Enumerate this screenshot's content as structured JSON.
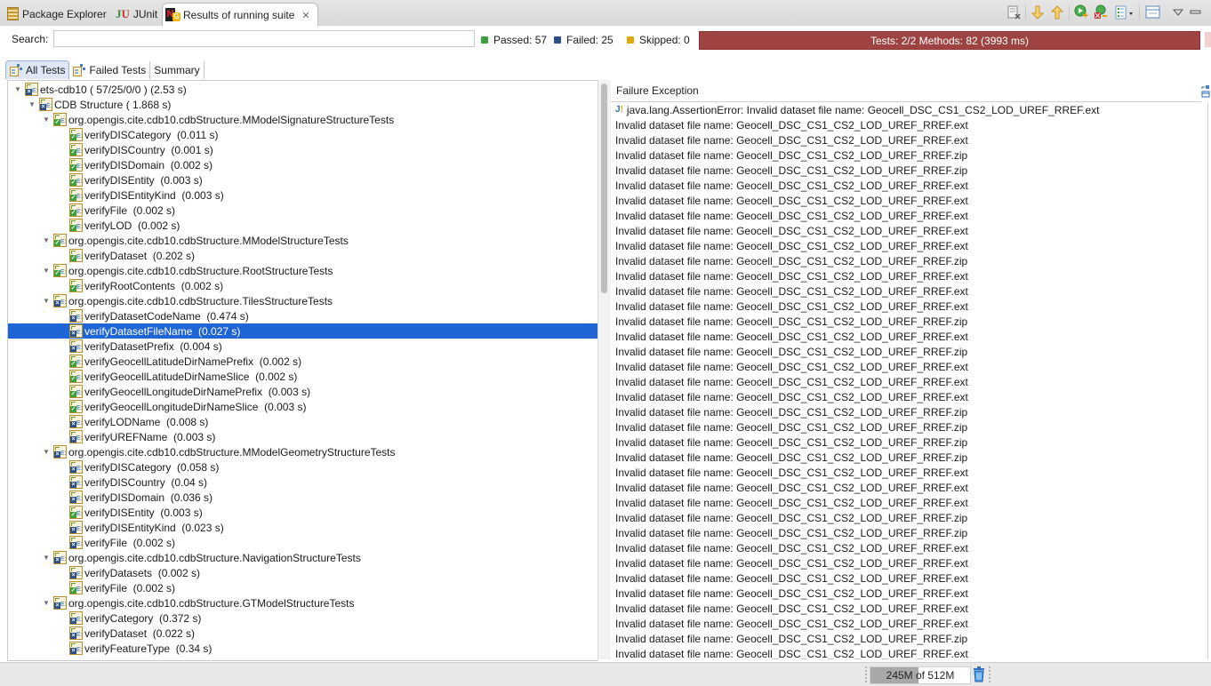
{
  "tabs": [
    {
      "label": "Package Explorer",
      "icon": "package-explorer-icon",
      "active": false
    },
    {
      "label": "JUnit",
      "icon": "junit-icon",
      "active": false
    },
    {
      "label": "Results of running suite",
      "icon": "testng-icon",
      "active": true,
      "closable": true
    }
  ],
  "toolbar": {
    "buttons": [
      "clear-results-icon",
      "next-failure-icon",
      "previous-failure-icon",
      "rerun-icon",
      "rerun-failed-icon",
      "history-menu-icon",
      "layout-icon",
      "view-menu-icon",
      "minimize-icon"
    ]
  },
  "search": {
    "label": "Search:",
    "value": "",
    "placeholder": ""
  },
  "stats": {
    "passed": "Passed: 57",
    "failed": "Failed: 25",
    "skipped": "Skipped: 0"
  },
  "progress": {
    "text": "Tests: 2/2  Methods: 82 (3993 ms)",
    "status_color": "#9e4242",
    "fraction": 1.0
  },
  "subtabs": [
    {
      "label": "All Tests",
      "active": true
    },
    {
      "label": "Failed Tests",
      "active": false
    },
    {
      "label": "Summary",
      "active": false
    }
  ],
  "tree": [
    {
      "level": 0,
      "expand": true,
      "status": "fail",
      "label": "ets-cdb10 ( 57/25/0/0 ) (2.53 s)"
    },
    {
      "level": 1,
      "expand": true,
      "status": "fail",
      "label": "CDB Structure ( 1.868 s)"
    },
    {
      "level": 2,
      "expand": true,
      "status": "pass",
      "label": "org.opengis.cite.cdb10.cdbStructure.MModelSignatureStructureTests"
    },
    {
      "level": 3,
      "status": "pass",
      "label": "verifyDISCategory  (0.011 s)"
    },
    {
      "level": 3,
      "status": "pass",
      "label": "verifyDISCountry  (0.001 s)"
    },
    {
      "level": 3,
      "status": "pass",
      "label": "verifyDISDomain  (0.002 s)"
    },
    {
      "level": 3,
      "status": "pass",
      "label": "verifyDISEntity  (0.003 s)"
    },
    {
      "level": 3,
      "status": "pass",
      "label": "verifyDISEntityKind  (0.003 s)"
    },
    {
      "level": 3,
      "status": "pass",
      "label": "verifyFile  (0.002 s)"
    },
    {
      "level": 3,
      "status": "pass",
      "label": "verifyLOD  (0.002 s)"
    },
    {
      "level": 2,
      "expand": true,
      "status": "pass",
      "label": "org.opengis.cite.cdb10.cdbStructure.MModelStructureTests"
    },
    {
      "level": 3,
      "status": "pass",
      "label": "verifyDataset  (0.202 s)"
    },
    {
      "level": 2,
      "expand": true,
      "status": "pass",
      "label": "org.opengis.cite.cdb10.cdbStructure.RootStructureTests"
    },
    {
      "level": 3,
      "status": "pass",
      "label": "verifyRootContents  (0.002 s)"
    },
    {
      "level": 2,
      "expand": true,
      "status": "fail",
      "label": "org.opengis.cite.cdb10.cdbStructure.TilesStructureTests"
    },
    {
      "level": 3,
      "status": "fail",
      "label": "verifyDatasetCodeName  (0.474 s)"
    },
    {
      "level": 3,
      "status": "fail",
      "label": "verifyDatasetFileName  (0.027 s)",
      "selected": true
    },
    {
      "level": 3,
      "status": "fail",
      "label": "verifyDatasetPrefix  (0.004 s)"
    },
    {
      "level": 3,
      "status": "pass",
      "label": "verifyGeocellLatitudeDirNamePrefix  (0.002 s)"
    },
    {
      "level": 3,
      "status": "pass",
      "label": "verifyGeocellLatitudeDirNameSlice  (0.002 s)"
    },
    {
      "level": 3,
      "status": "pass",
      "label": "verifyGeocellLongitudeDirNamePrefix  (0.003 s)"
    },
    {
      "level": 3,
      "status": "pass",
      "label": "verifyGeocellLongitudeDirNameSlice  (0.003 s)"
    },
    {
      "level": 3,
      "status": "fail",
      "label": "verifyLODName  (0.008 s)"
    },
    {
      "level": 3,
      "status": "fail",
      "label": "verifyUREFName  (0.003 s)"
    },
    {
      "level": 2,
      "expand": true,
      "status": "fail",
      "label": "org.opengis.cite.cdb10.cdbStructure.MModelGeometryStructureTests"
    },
    {
      "level": 3,
      "status": "fail",
      "label": "verifyDISCategory  (0.058 s)"
    },
    {
      "level": 3,
      "status": "fail",
      "label": "verifyDISCountry  (0.04 s)"
    },
    {
      "level": 3,
      "status": "fail",
      "label": "verifyDISDomain  (0.036 s)"
    },
    {
      "level": 3,
      "status": "pass",
      "label": "verifyDISEntity  (0.003 s)"
    },
    {
      "level": 3,
      "status": "fail",
      "label": "verifyDISEntityKind  (0.023 s)"
    },
    {
      "level": 3,
      "status": "fail",
      "label": "verifyFile  (0.002 s)"
    },
    {
      "level": 2,
      "expand": true,
      "status": "fail",
      "label": "org.opengis.cite.cdb10.cdbStructure.NavigationStructureTests"
    },
    {
      "level": 3,
      "status": "fail",
      "label": "verifyDatasets  (0.002 s)"
    },
    {
      "level": 3,
      "status": "pass",
      "label": "verifyFile  (0.002 s)"
    },
    {
      "level": 2,
      "expand": true,
      "status": "fail",
      "label": "org.opengis.cite.cdb10.cdbStructure.GTModelStructureTests"
    },
    {
      "level": 3,
      "status": "fail",
      "label": "verifyCategory  (0.372 s)"
    },
    {
      "level": 3,
      "status": "fail",
      "label": "verifyDataset  (0.022 s)"
    },
    {
      "level": 3,
      "status": "fail",
      "label": "verifyFeatureType  (0.34 s)"
    }
  ],
  "failure": {
    "header": "Failure Exception",
    "first_line": "java.lang.AssertionError: Invalid dataset file name: Geocell_DSC_CS1_CS2_LOD_UREF_RREF.ext",
    "line_prefix": "Invalid dataset file name: Geocell_DSC_CS1_CS2_LOD_UREF_RREF.",
    "lines": [
      "Invalid dataset file name: Geocell_DSC_CS1_CS2_LOD_UREF_RREF.ext",
      "Invalid dataset file name: Geocell_DSC_CS1_CS2_LOD_UREF_RREF.ext",
      "Invalid dataset file name: Geocell_DSC_CS1_CS2_LOD_UREF_RREF.zip",
      "Invalid dataset file name: Geocell_DSC_CS1_CS2_LOD_UREF_RREF.zip",
      "Invalid dataset file name: Geocell_DSC_CS1_CS2_LOD_UREF_RREF.ext",
      "Invalid dataset file name: Geocell_DSC_CS1_CS2_LOD_UREF_RREF.ext",
      "Invalid dataset file name: Geocell_DSC_CS1_CS2_LOD_UREF_RREF.ext",
      "Invalid dataset file name: Geocell_DSC_CS1_CS2_LOD_UREF_RREF.ext",
      "Invalid dataset file name: Geocell_DSC_CS1_CS2_LOD_UREF_RREF.ext",
      "Invalid dataset file name: Geocell_DSC_CS1_CS2_LOD_UREF_RREF.zip",
      "Invalid dataset file name: Geocell_DSC_CS1_CS2_LOD_UREF_RREF.ext",
      "Invalid dataset file name: Geocell_DSC_CS1_CS2_LOD_UREF_RREF.ext",
      "Invalid dataset file name: Geocell_DSC_CS1_CS2_LOD_UREF_RREF.ext",
      "Invalid dataset file name: Geocell_DSC_CS1_CS2_LOD_UREF_RREF.zip",
      "Invalid dataset file name: Geocell_DSC_CS1_CS2_LOD_UREF_RREF.ext",
      "Invalid dataset file name: Geocell_DSC_CS1_CS2_LOD_UREF_RREF.zip",
      "Invalid dataset file name: Geocell_DSC_CS1_CS2_LOD_UREF_RREF.ext",
      "Invalid dataset file name: Geocell_DSC_CS1_CS2_LOD_UREF_RREF.ext",
      "Invalid dataset file name: Geocell_DSC_CS1_CS2_LOD_UREF_RREF.ext",
      "Invalid dataset file name: Geocell_DSC_CS1_CS2_LOD_UREF_RREF.zip",
      "Invalid dataset file name: Geocell_DSC_CS1_CS2_LOD_UREF_RREF.zip",
      "Invalid dataset file name: Geocell_DSC_CS1_CS2_LOD_UREF_RREF.zip",
      "Invalid dataset file name: Geocell_DSC_CS1_CS2_LOD_UREF_RREF.zip",
      "Invalid dataset file name: Geocell_DSC_CS1_CS2_LOD_UREF_RREF.ext",
      "Invalid dataset file name: Geocell_DSC_CS1_CS2_LOD_UREF_RREF.ext",
      "Invalid dataset file name: Geocell_DSC_CS1_CS2_LOD_UREF_RREF.ext",
      "Invalid dataset file name: Geocell_DSC_CS1_CS2_LOD_UREF_RREF.zip",
      "Invalid dataset file name: Geocell_DSC_CS1_CS2_LOD_UREF_RREF.zip",
      "Invalid dataset file name: Geocell_DSC_CS1_CS2_LOD_UREF_RREF.ext",
      "Invalid dataset file name: Geocell_DSC_CS1_CS2_LOD_UREF_RREF.ext",
      "Invalid dataset file name: Geocell_DSC_CS1_CS2_LOD_UREF_RREF.ext",
      "Invalid dataset file name: Geocell_DSC_CS1_CS2_LOD_UREF_RREF.ext",
      "Invalid dataset file name: Geocell_DSC_CS1_CS2_LOD_UREF_RREF.ext",
      "Invalid dataset file name: Geocell_DSC_CS1_CS2_LOD_UREF_RREF.ext",
      "Invalid dataset file name: Geocell_DSC_CS1_CS2_LOD_UREF_RREF.zip",
      "Invalid dataset file name: Geocell_DSC_CS1_CS2_LOD_UREF_RREF.ext"
    ]
  },
  "status_bar": {
    "heap_text": "245M of 512M",
    "heap_used_fraction": 0.478,
    "gc_icon": "trash-icon"
  }
}
